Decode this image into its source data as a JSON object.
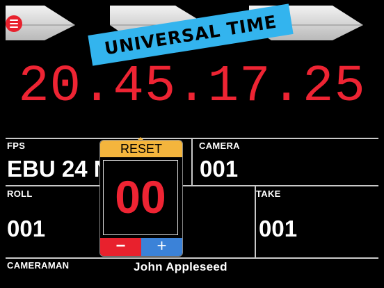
{
  "header": {
    "menu_icon": "hamburger-icon",
    "badge": "UNIVERSAL TIME"
  },
  "timecode": {
    "hours": "20",
    "minutes": "45",
    "seconds": "17",
    "frames": "25",
    "separator": "."
  },
  "slate": {
    "fps": {
      "label": "FPS",
      "value": "EBU 24 N"
    },
    "camera": {
      "label": "CAMERA",
      "value": "001"
    },
    "roll": {
      "label": "ROLL",
      "value": "001"
    },
    "take": {
      "label": "TAKE",
      "value": "001"
    },
    "cameraman": {
      "label": "CAMERAMAN",
      "value": "John Appleseed"
    }
  },
  "counter_popover": {
    "reset_label": "RESET",
    "value": "00",
    "minus_label": "−",
    "plus_label": "+"
  },
  "colors": {
    "timecode": "#ee2433",
    "badge": "#33b4ee",
    "reset": "#f4b53d",
    "minus": "#e8212d",
    "plus": "#3b82d8"
  }
}
